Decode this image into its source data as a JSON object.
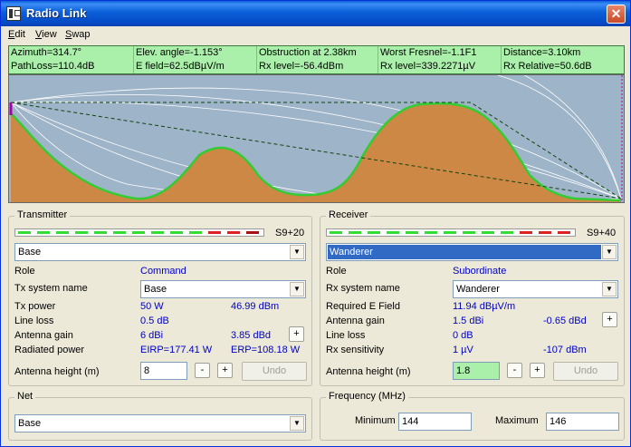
{
  "window": {
    "title": "Radio Link",
    "close_symbol": "✕"
  },
  "menu": [
    {
      "key": "E",
      "rest": "dit"
    },
    {
      "key": "V",
      "rest": "iew"
    },
    {
      "key": "S",
      "rest": "wap"
    }
  ],
  "info": {
    "row1": [
      "Azimuth=314.7°",
      "Elev. angle=-1.153°",
      "Obstruction at 2.38km",
      "Worst Fresnel=-1.1F1",
      "Distance=3.10km"
    ],
    "row2": [
      "PathLoss=110.4dB",
      "E field=62.5dBµV/m",
      "Rx level=-56.4dBm",
      "Rx level=339.2271µV",
      "Rx Relative=50.6dB"
    ]
  },
  "profile": {
    "terrain_color": "#cc8844",
    "terrain_line_color": "#33cc33",
    "sky_color": "#9eb4c8"
  },
  "transmitter": {
    "legend": "Transmitter",
    "meter_label": "S9+20",
    "meter_segments": [
      "#33dd33",
      "#33dd33",
      "#33dd33",
      "#33dd33",
      "#33dd33",
      "#33dd33",
      "#33dd33",
      "#33dd33",
      "#33dd33",
      "#33dd33",
      "#dd2222",
      "#dd2222",
      "#aa1111"
    ],
    "unit": "Base",
    "role_label": "Role",
    "role_value": "Command",
    "system_label": "Tx system name",
    "system_value": "Base",
    "power_label": "Tx power",
    "power_w": "50 W",
    "power_dbm": "46.99 dBm",
    "loss_label": "Line loss",
    "loss_value": "0.5 dB",
    "gain_label": "Antenna gain",
    "gain_dbi": "6 dBi",
    "gain_dbd": "3.85 dBd",
    "radiated_label": "Radiated power",
    "eirp": "EIRP=177.41 W",
    "erp": "ERP=108.18 W",
    "height_label": "Antenna height (m)",
    "height_value": "8",
    "minus": "-",
    "plus": "+",
    "undo": "Undo"
  },
  "receiver": {
    "legend": "Receiver",
    "meter_label": "S9+40",
    "meter_segments": [
      "#33dd33",
      "#33dd33",
      "#33dd33",
      "#33dd33",
      "#33dd33",
      "#33dd33",
      "#33dd33",
      "#33dd33",
      "#33dd33",
      "#33dd33",
      "#dd2222",
      "#dd2222",
      "#dd2222"
    ],
    "unit": "Wanderer",
    "role_label": "Role",
    "role_value": "Subordinate",
    "system_label": "Rx system name",
    "system_value": "Wanderer",
    "field_label": "Required E Field",
    "field_value": "11.94 dBµV/m",
    "gain_label": "Antenna gain",
    "gain_dbi": "1.5 dBi",
    "gain_dbd": "-0.65 dBd",
    "loss_label": "Line loss",
    "loss_value": "0 dB",
    "sens_label": "Rx sensitivity",
    "sens_uv": "1 µV",
    "sens_dbm": "-107 dBm",
    "height_label": "Antenna height (m)",
    "height_value": "1.8",
    "minus": "-",
    "plus": "+",
    "undo": "Undo"
  },
  "net": {
    "legend": "Net",
    "value": "Base"
  },
  "frequency": {
    "legend": "Frequency (MHz)",
    "min_label": "Minimum",
    "min_value": "144",
    "max_label": "Maximum",
    "max_value": "146"
  },
  "icons": {
    "dropdown": "▼"
  }
}
